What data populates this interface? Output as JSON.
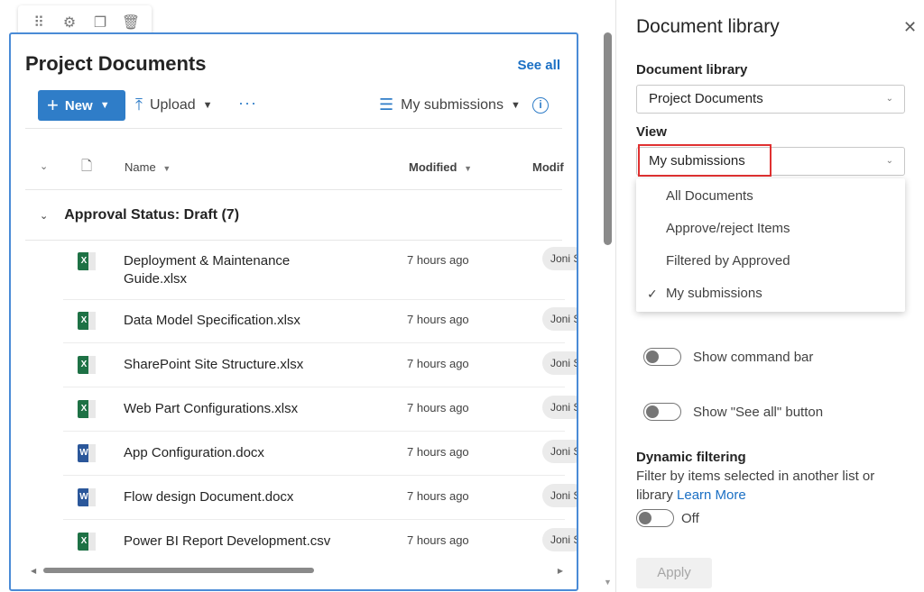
{
  "webpart": {
    "title": "Project Documents",
    "see_all": "See all",
    "commands": {
      "new": "New",
      "upload": "Upload",
      "more": "···",
      "view": "My submissions",
      "info": "i"
    },
    "columns": {
      "name": "Name",
      "modified": "Modified",
      "modified_by": "Modif"
    },
    "group_header": "Approval Status: Draft (7)",
    "files": [
      {
        "name_line1": "Deployment & Maintenance",
        "name_line2": "Guide.xlsx",
        "type": "excel",
        "modified": "7 hours ago",
        "user": "Joni S"
      },
      {
        "name_line1": "Data Model Specification.xlsx",
        "name_line2": "",
        "type": "excel",
        "modified": "7 hours ago",
        "user": "Joni S"
      },
      {
        "name_line1": "SharePoint Site Structure.xlsx",
        "name_line2": "",
        "type": "excel",
        "modified": "7 hours ago",
        "user": "Joni S"
      },
      {
        "name_line1": "Web Part Configurations.xlsx",
        "name_line2": "",
        "type": "excel",
        "modified": "7 hours ago",
        "user": "Joni S"
      },
      {
        "name_line1": "App Configuration.docx",
        "name_line2": "",
        "type": "word",
        "modified": "7 hours ago",
        "user": "Joni S"
      },
      {
        "name_line1": "Flow design Document.docx",
        "name_line2": "",
        "type": "word",
        "modified": "7 hours ago",
        "user": "Joni S"
      },
      {
        "name_line1": "Power BI Report Development.csv",
        "name_line2": "",
        "type": "excel",
        "modified": "7 hours ago",
        "user": "Joni S"
      }
    ]
  },
  "pane": {
    "title": "Document library",
    "close": "✕",
    "library_label": "Document library",
    "library_value": "Project Documents",
    "view_label": "View",
    "view_value": "My submissions",
    "view_options": [
      "All Documents",
      "Approve/reject Items",
      "Filtered by Approved",
      "My submissions"
    ],
    "view_selected_index": 3,
    "show_command_bar": "Show command bar",
    "show_see_all": "Show \"See all\" button",
    "dynamic_filtering_label": "Dynamic filtering",
    "dynamic_filtering_desc": "Filter by items selected in another list or library",
    "learn_more": "Learn More",
    "dynamic_state": "Off",
    "apply": "Apply"
  },
  "colors": {
    "accent": "#2f7dc8",
    "excel": "#1e7145",
    "word": "#2b579a",
    "highlight": "#e03131"
  }
}
